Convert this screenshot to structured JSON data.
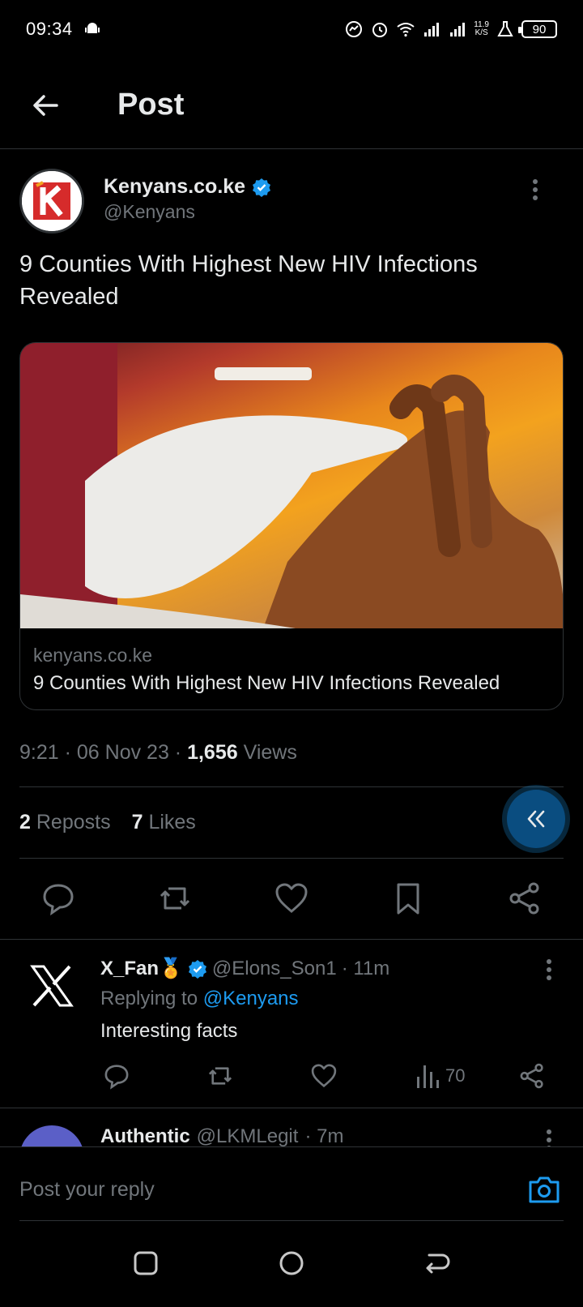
{
  "status_bar": {
    "time": "09:34",
    "speed_top": "11.9",
    "speed_bottom": "K/S",
    "battery": "90"
  },
  "header": {
    "title": "Post"
  },
  "post": {
    "author_name": "Kenyans.co.ke",
    "author_handle": "@Kenyans",
    "text": "9 Counties With Highest New HIV Infections Revealed",
    "card_domain": "kenyans.co.ke",
    "card_title": "9 Counties With Highest New HIV Infections Revealed",
    "time": "9:21",
    "date": "06 Nov 23",
    "views_count": "1,656",
    "views_label": "Views",
    "reposts_count": "2",
    "reposts_label": "Reposts",
    "likes_count": "7",
    "likes_label": "Likes"
  },
  "replies": [
    {
      "name": "X_Fan🏅",
      "handle": "@Elons_Son1",
      "time": "· 11m",
      "replying_prefix": "Replying to",
      "replying_to": "@Kenyans",
      "text": "Interesting facts",
      "views": "70"
    },
    {
      "name": "Authentic",
      "handle": "@LKMLegit",
      "time": "· 7m"
    }
  ],
  "composer": {
    "placeholder": "Post your reply"
  },
  "colors": {
    "accent": "#1d9bf0",
    "muted": "#71767b",
    "text": "#e7e9ea",
    "background": "#000000",
    "brand_red": "#d62b2b"
  }
}
